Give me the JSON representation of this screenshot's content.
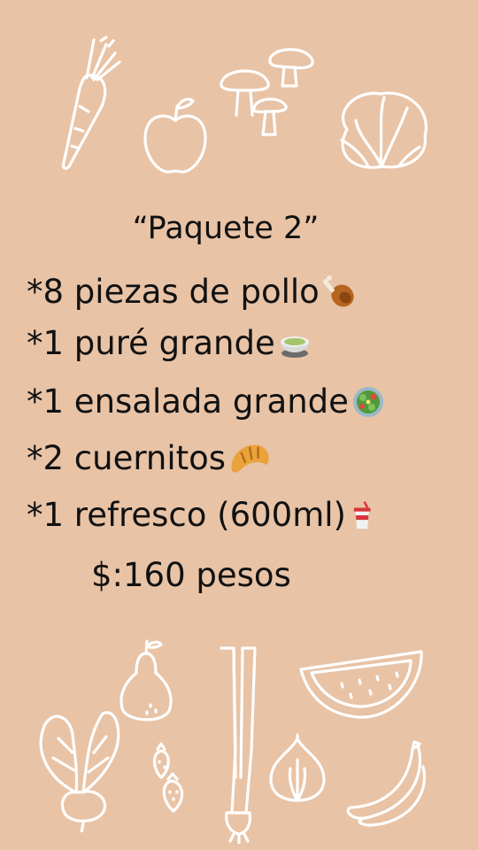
{
  "title": "“Paquete 2”",
  "items": [
    {
      "text": "*8 piezas de pollo",
      "icon": "chicken-leg-icon"
    },
    {
      "text": "*1 puré grande",
      "icon": "mashed-bowl-icon"
    },
    {
      "text": "*1 ensalada grande",
      "icon": "salad-icon"
    },
    {
      "text": "*2 cuernitos",
      "icon": "croissant-icon"
    },
    {
      "text": "*1 refresco (600ml)",
      "icon": "soda-cup-icon"
    }
  ],
  "price": "$:160 pesos",
  "colors": {
    "background": "#e8c3a6",
    "doodle": "#ffffff",
    "text": "#111111"
  }
}
